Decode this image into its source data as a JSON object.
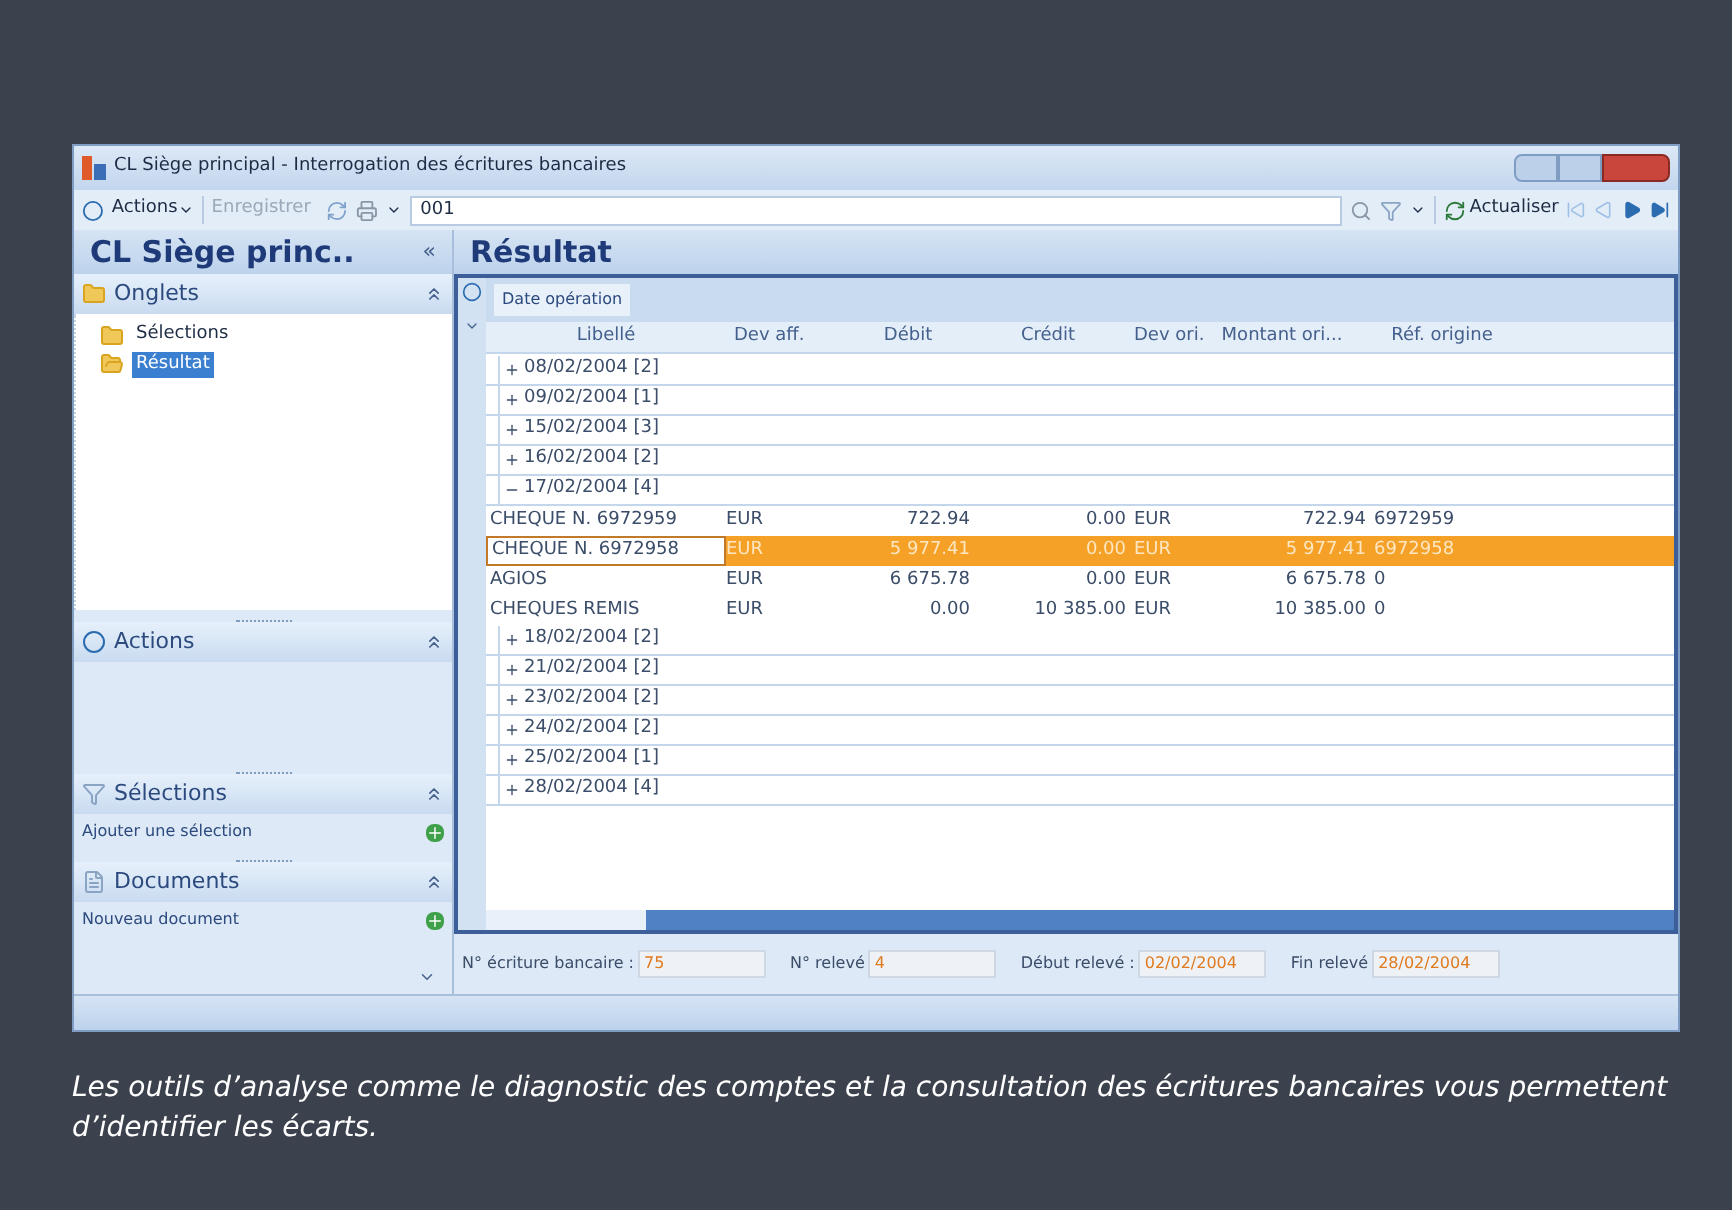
{
  "window": {
    "title": "CL Siège principal - Interrogation des écritures bancaires"
  },
  "toolbar": {
    "actions": "Actions",
    "save": "Enregistrer",
    "search_value": "001",
    "refresh": "Actualiser"
  },
  "left_panel": {
    "title": "CL Siège princ..",
    "collapse": "«",
    "sections": [
      {
        "kind": "tree",
        "title": "Onglets",
        "children": [
          {
            "label": "Sélections",
            "selected": false
          },
          {
            "label": "Résultat",
            "selected": true
          }
        ]
      },
      {
        "kind": "actions",
        "title": "Actions"
      },
      {
        "kind": "filter",
        "title": "Sélections",
        "items": [
          "Ajouter une sélection"
        ]
      },
      {
        "kind": "documents",
        "title": "Documents",
        "items": [
          "Nouveau document"
        ]
      }
    ]
  },
  "result": {
    "title": "Résultat",
    "group_tab": "Date opération",
    "columns": [
      "Libellé",
      "Dev aff.",
      "Débit",
      "Crédit",
      "Dev ori.",
      "Montant ori...",
      "Réf. origine"
    ],
    "rows": [
      {
        "kind": "group",
        "label": "08/02/2004 [2]",
        "expanded": false
      },
      {
        "kind": "group",
        "label": "09/02/2004 [1]",
        "expanded": false
      },
      {
        "kind": "group",
        "label": "15/02/2004 [3]",
        "expanded": false
      },
      {
        "kind": "group",
        "label": "16/02/2004 [2]",
        "expanded": false
      },
      {
        "kind": "group",
        "label": "17/02/2004 [4]",
        "expanded": true
      },
      {
        "kind": "entry",
        "selected": false,
        "cells": [
          "CHEQUE N. 6972959",
          "EUR",
          "722.94",
          "0.00",
          "EUR",
          "722.94",
          "6972959"
        ]
      },
      {
        "kind": "entry",
        "selected": true,
        "cells": [
          "CHEQUE N. 6972958",
          "EUR",
          "5 977.41",
          "0.00",
          "EUR",
          "5 977.41",
          "6972958"
        ]
      },
      {
        "kind": "entry",
        "selected": false,
        "cells": [
          "AGIOS",
          "EUR",
          "6 675.78",
          "0.00",
          "EUR",
          "6 675.78",
          "0"
        ]
      },
      {
        "kind": "entry",
        "selected": false,
        "cells": [
          "CHEQUES REMIS",
          "EUR",
          "0.00",
          "10 385.00",
          "EUR",
          "10 385.00",
          "0"
        ]
      },
      {
        "kind": "group",
        "label": "18/02/2004 [2]",
        "expanded": false
      },
      {
        "kind": "group",
        "label": "21/02/2004 [2]",
        "expanded": false
      },
      {
        "kind": "group",
        "label": "23/02/2004 [2]",
        "expanded": false
      },
      {
        "kind": "group",
        "label": "24/02/2004 [2]",
        "expanded": false
      },
      {
        "kind": "group",
        "label": "25/02/2004 [1]",
        "expanded": false
      },
      {
        "kind": "group",
        "label": "28/02/2004 [4]",
        "expanded": false
      }
    ],
    "fields": [
      {
        "label": "N° écriture bancaire :",
        "value": "75"
      },
      {
        "label": "N° relevé",
        "value": "4"
      },
      {
        "label": "Début relevé :",
        "value": "02/02/2004"
      },
      {
        "label": "Fin relevé",
        "value": "28/02/2004"
      }
    ]
  },
  "caption": "Les outils d’analyse comme le diagnostic des comptes et la consultation des écritures bancaires vous permettent d’identifier les écarts."
}
